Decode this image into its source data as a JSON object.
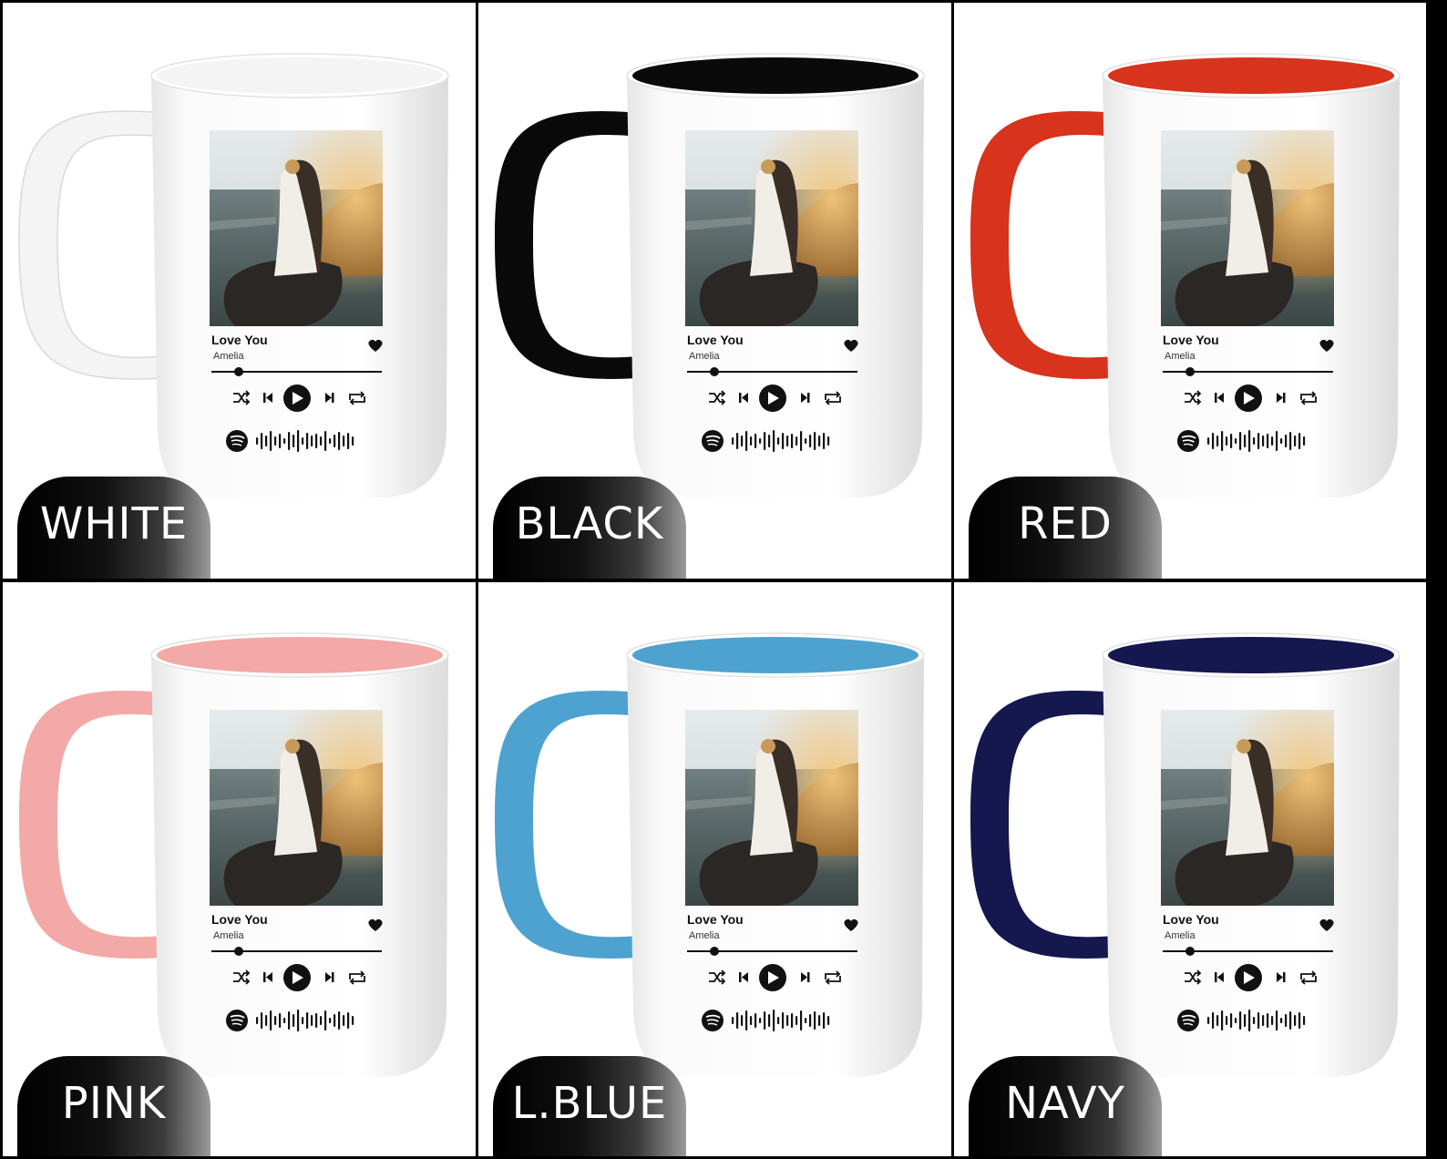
{
  "song": {
    "title": "Love You",
    "artist": "Amelia"
  },
  "colors": {
    "label_text": "#ffffff",
    "pill_dark": "#000000",
    "pill_light": "#9a9a9a"
  },
  "variants": [
    {
      "label": "WHITE",
      "accent": "#f4f4f4"
    },
    {
      "label": "BLACK",
      "accent": "#0a0a0a"
    },
    {
      "label": "RED",
      "accent": "#d8331c"
    },
    {
      "label": "PINK",
      "accent": "#f2a9a7"
    },
    {
      "label": "L.BLUE",
      "accent": "#4ea2cf"
    },
    {
      "label": "NAVY",
      "accent": "#15174f"
    }
  ],
  "icons": [
    "shuffle-icon",
    "previous-icon",
    "play-icon",
    "next-icon",
    "repeat-icon",
    "heart-icon",
    "spotify-icon",
    "spotify-code-icon"
  ]
}
